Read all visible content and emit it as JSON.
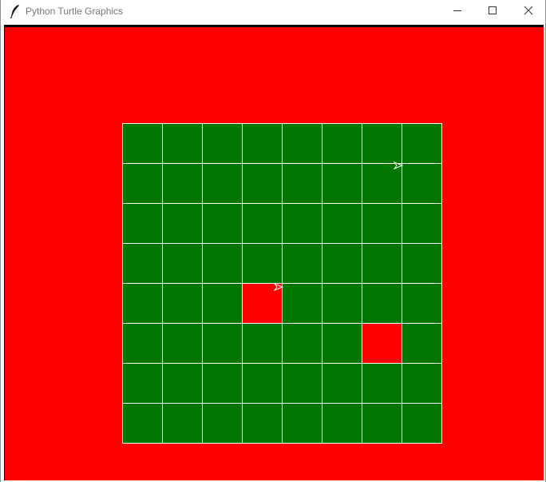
{
  "window": {
    "title": "Python Turtle Graphics",
    "icon": "feather-icon",
    "controls": {
      "minimize_icon": "minimize-icon",
      "maximize_icon": "maximize-icon",
      "close_icon": "close-icon"
    }
  },
  "canvas": {
    "background_color": "#ff0000",
    "board": {
      "rows": 8,
      "cols": 8,
      "cell_color": "#007700",
      "highlight_color": "#ff0000",
      "grid_line_color": "#ffffff",
      "highlighted_cells": [
        {
          "row": 4,
          "col": 3
        },
        {
          "row": 5,
          "col": 6
        }
      ]
    },
    "turtles": [
      {
        "shape": "arrow-icon",
        "heading": "right",
        "color": "#ffffff"
      },
      {
        "shape": "arrow-icon",
        "heading": "right",
        "color": "#ffffff"
      }
    ]
  }
}
